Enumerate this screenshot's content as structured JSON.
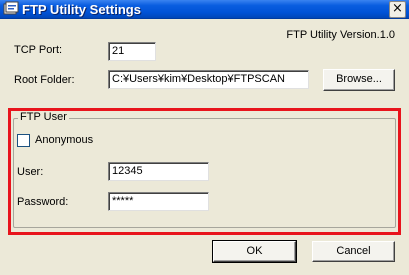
{
  "window": {
    "title": "FTP Utility Settings",
    "close_label": "×"
  },
  "version_text": "FTP Utility Version.1.0",
  "tcp_port": {
    "label": "TCP Port:",
    "value": "21"
  },
  "root_folder": {
    "label": "Root Folder:",
    "value": "C:¥Users¥kim¥Desktop¥FTPSCAN",
    "browse_label": "Browse..."
  },
  "ftp_user": {
    "group_title": "FTP User",
    "anonymous_label": "Anonymous",
    "anonymous_checked": false,
    "user_label": "User:",
    "user_value": "12345",
    "password_label": "Password:",
    "password_value": "*****"
  },
  "buttons": {
    "ok_label": "OK",
    "cancel_label": "Cancel"
  },
  "colors": {
    "highlight_border": "#e8141c",
    "titlebar": "#0052d6",
    "window_bg": "#ece9d8"
  }
}
